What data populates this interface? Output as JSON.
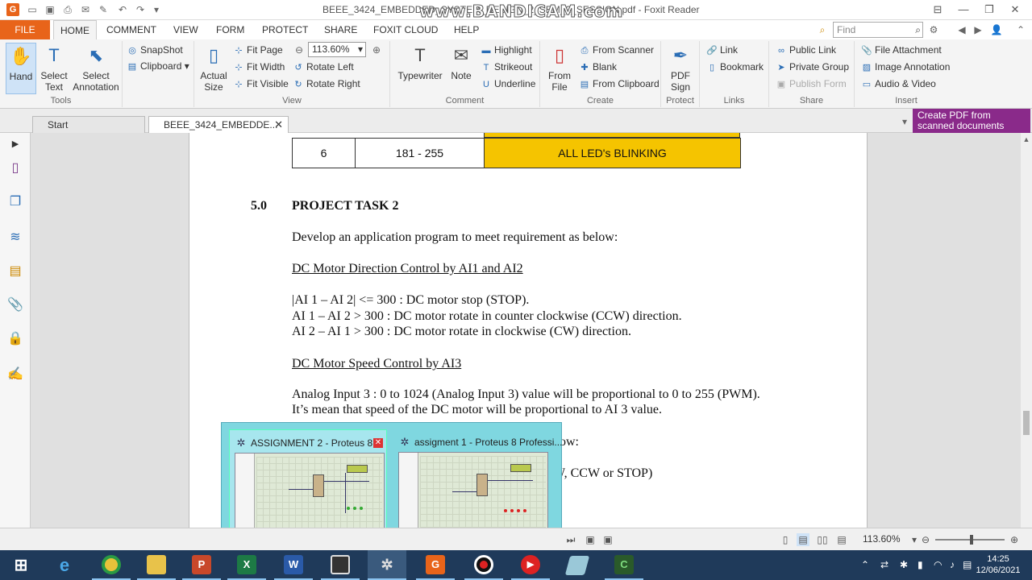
{
  "window": {
    "title": "BEEE_3424_EMBEDDED_SYSTEM_DESIGN_2_SEM_2_SESSION.pdf - Foxit Reader",
    "watermark": "www.BANDICAM.com",
    "app_logo": "G"
  },
  "menu": {
    "file": "FILE",
    "tabs": [
      "HOME",
      "COMMENT",
      "VIEW",
      "FORM",
      "PROTECT",
      "SHARE",
      "FOXIT CLOUD",
      "HELP"
    ],
    "find_placeholder": "Find"
  },
  "ribbon": {
    "tools": {
      "hand": "Hand",
      "select_text": "Select Text",
      "select_annotation": "Select Annotation",
      "label": "Tools"
    },
    "snap": {
      "snapshot": "SnapShot",
      "clipboard": "Clipboard"
    },
    "view": {
      "actual_size": "Actual Size",
      "fit_page": "Fit Page",
      "fit_width": "Fit Width",
      "fit_visible": "Fit Visible",
      "zoom": "113.60%",
      "rotate_left": "Rotate Left",
      "rotate_right": "Rotate Right",
      "label": "View"
    },
    "comment": {
      "typewriter": "Typewriter",
      "note": "Note",
      "highlight": "Highlight",
      "strikeout": "Strikeout",
      "underline": "Underline",
      "label": "Comment"
    },
    "create": {
      "from_file": "From File",
      "from_scanner": "From Scanner",
      "blank": "Blank",
      "from_clipboard": "From Clipboard",
      "label": "Create"
    },
    "protect": {
      "pdf_sign": "PDF Sign",
      "label": "Protect"
    },
    "links": {
      "link": "Link",
      "bookmark": "Bookmark",
      "label": "Links"
    },
    "share": {
      "public_link": "Public Link",
      "private_group": "Private Group",
      "publish_form": "Publish Form",
      "label": "Share"
    },
    "insert": {
      "file_attachment": "File Attachment",
      "image_annotation": "Image Annotation",
      "audio_video": "Audio & Video",
      "label": "Insert"
    }
  },
  "doc_tabs": {
    "start": "Start",
    "current": "BEEE_3424_EMBEDDE...",
    "promo": "Create PDF from scanned documents"
  },
  "document": {
    "table_row": {
      "no": "6",
      "range": "181 - 255",
      "status": "ALL LED's BLINKING"
    },
    "section_no": "5.0",
    "section_title": "PROJECT TASK 2",
    "intro": "Develop an application program to meet requirement as below:",
    "heading1": "DC Motor Direction Control by AI1 and AI2",
    "line1": "|AI 1 – AI 2| <= 300 : DC motor stop (STOP).",
    "line2": "AI 1 – AI 2 > 300 : DC motor rotate in counter clockwise (CCW) direction.",
    "line3": "AI 2 – AI 1 > 300 : DC motor rotate in clockwise (CW) direction.",
    "heading2": "DC Motor Speed Control by AI3",
    "line4": "Analog Input 3 : 0 to 1024 (Analog Input 3) value will be proportional to 0 to 255 (PWM).",
    "line5": "It’s mean that speed of the DC motor will be proportional to AI 3 value.",
    "partial1": "ow:",
    "partial2": "W, CCW or STOP)"
  },
  "thumbnails": [
    {
      "title": "ASSIGNMENT 2 - Proteus 8 ..."
    },
    {
      "title": "assigment 1 - Proteus 8 Professi..."
    }
  ],
  "status": {
    "zoom": "113.60%"
  },
  "taskbar": {
    "apps": [
      "windows-start",
      "internet-explorer",
      "chrome",
      "file-explorer",
      "powerpoint",
      "excel",
      "word",
      "calculator-app",
      "proteus",
      "foxit-reader",
      "bandicam",
      "youtube-player",
      "notes-app",
      "proteus-isis"
    ],
    "time": "14:25",
    "date": "12/06/2021"
  },
  "colors": {
    "accent": "#e8641a",
    "table_yellow": "#f5c400",
    "taskbar": "#1f3a5a",
    "popup": "#7fd7e0"
  }
}
